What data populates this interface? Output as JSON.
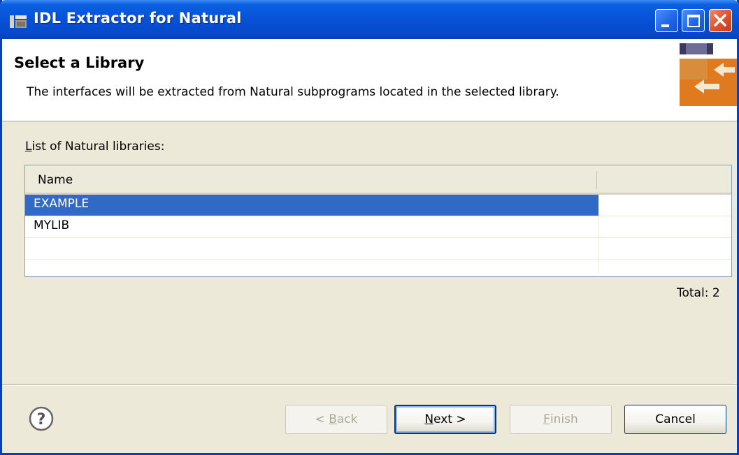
{
  "window": {
    "title": "IDL Extractor for Natural",
    "title_bar_color": "#0752d6",
    "close_button_color": "#e0502c"
  },
  "header": {
    "title": "Select a Library",
    "description": "The interfaces will be extracted from Natural subprograms located in the selected library."
  },
  "list": {
    "label_first_char": "L",
    "label_rest": "ist of Natural libraries:",
    "columns": [
      "Name",
      ""
    ],
    "rows": [
      {
        "name": "EXAMPLE",
        "selected": true
      },
      {
        "name": "MYLIB",
        "selected": false
      }
    ],
    "selection_color": "#316ac5",
    "total": "Total: 2"
  },
  "buttons": {
    "back_prefix": "< ",
    "back_mnemonic": "B",
    "back_rest": "ack",
    "next_mnemonic": "N",
    "next_rest": "ext >",
    "finish_mnemonic": "F",
    "finish_rest": "inish",
    "cancel": "Cancel"
  },
  "icons": {
    "title": "eclipse-window-icon",
    "wizard": "extract-arrows-icon",
    "help": "help-question-icon"
  }
}
